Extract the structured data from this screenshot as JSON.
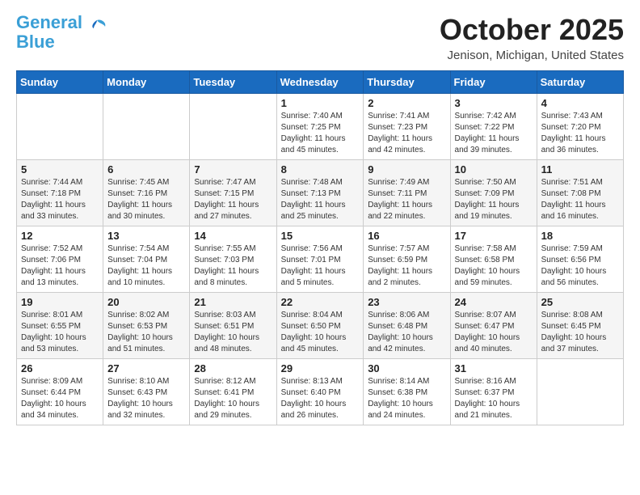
{
  "header": {
    "logo_line1": "General",
    "logo_line2": "Blue",
    "month_title": "October 2025",
    "location": "Jenison, Michigan, United States"
  },
  "days_of_week": [
    "Sunday",
    "Monday",
    "Tuesday",
    "Wednesday",
    "Thursday",
    "Friday",
    "Saturday"
  ],
  "weeks": [
    [
      {
        "num": "",
        "info": ""
      },
      {
        "num": "",
        "info": ""
      },
      {
        "num": "",
        "info": ""
      },
      {
        "num": "1",
        "info": "Sunrise: 7:40 AM\nSunset: 7:25 PM\nDaylight: 11 hours and 45 minutes."
      },
      {
        "num": "2",
        "info": "Sunrise: 7:41 AM\nSunset: 7:23 PM\nDaylight: 11 hours and 42 minutes."
      },
      {
        "num": "3",
        "info": "Sunrise: 7:42 AM\nSunset: 7:22 PM\nDaylight: 11 hours and 39 minutes."
      },
      {
        "num": "4",
        "info": "Sunrise: 7:43 AM\nSunset: 7:20 PM\nDaylight: 11 hours and 36 minutes."
      }
    ],
    [
      {
        "num": "5",
        "info": "Sunrise: 7:44 AM\nSunset: 7:18 PM\nDaylight: 11 hours and 33 minutes."
      },
      {
        "num": "6",
        "info": "Sunrise: 7:45 AM\nSunset: 7:16 PM\nDaylight: 11 hours and 30 minutes."
      },
      {
        "num": "7",
        "info": "Sunrise: 7:47 AM\nSunset: 7:15 PM\nDaylight: 11 hours and 27 minutes."
      },
      {
        "num": "8",
        "info": "Sunrise: 7:48 AM\nSunset: 7:13 PM\nDaylight: 11 hours and 25 minutes."
      },
      {
        "num": "9",
        "info": "Sunrise: 7:49 AM\nSunset: 7:11 PM\nDaylight: 11 hours and 22 minutes."
      },
      {
        "num": "10",
        "info": "Sunrise: 7:50 AM\nSunset: 7:09 PM\nDaylight: 11 hours and 19 minutes."
      },
      {
        "num": "11",
        "info": "Sunrise: 7:51 AM\nSunset: 7:08 PM\nDaylight: 11 hours and 16 minutes."
      }
    ],
    [
      {
        "num": "12",
        "info": "Sunrise: 7:52 AM\nSunset: 7:06 PM\nDaylight: 11 hours and 13 minutes."
      },
      {
        "num": "13",
        "info": "Sunrise: 7:54 AM\nSunset: 7:04 PM\nDaylight: 11 hours and 10 minutes."
      },
      {
        "num": "14",
        "info": "Sunrise: 7:55 AM\nSunset: 7:03 PM\nDaylight: 11 hours and 8 minutes."
      },
      {
        "num": "15",
        "info": "Sunrise: 7:56 AM\nSunset: 7:01 PM\nDaylight: 11 hours and 5 minutes."
      },
      {
        "num": "16",
        "info": "Sunrise: 7:57 AM\nSunset: 6:59 PM\nDaylight: 11 hours and 2 minutes."
      },
      {
        "num": "17",
        "info": "Sunrise: 7:58 AM\nSunset: 6:58 PM\nDaylight: 10 hours and 59 minutes."
      },
      {
        "num": "18",
        "info": "Sunrise: 7:59 AM\nSunset: 6:56 PM\nDaylight: 10 hours and 56 minutes."
      }
    ],
    [
      {
        "num": "19",
        "info": "Sunrise: 8:01 AM\nSunset: 6:55 PM\nDaylight: 10 hours and 53 minutes."
      },
      {
        "num": "20",
        "info": "Sunrise: 8:02 AM\nSunset: 6:53 PM\nDaylight: 10 hours and 51 minutes."
      },
      {
        "num": "21",
        "info": "Sunrise: 8:03 AM\nSunset: 6:51 PM\nDaylight: 10 hours and 48 minutes."
      },
      {
        "num": "22",
        "info": "Sunrise: 8:04 AM\nSunset: 6:50 PM\nDaylight: 10 hours and 45 minutes."
      },
      {
        "num": "23",
        "info": "Sunrise: 8:06 AM\nSunset: 6:48 PM\nDaylight: 10 hours and 42 minutes."
      },
      {
        "num": "24",
        "info": "Sunrise: 8:07 AM\nSunset: 6:47 PM\nDaylight: 10 hours and 40 minutes."
      },
      {
        "num": "25",
        "info": "Sunrise: 8:08 AM\nSunset: 6:45 PM\nDaylight: 10 hours and 37 minutes."
      }
    ],
    [
      {
        "num": "26",
        "info": "Sunrise: 8:09 AM\nSunset: 6:44 PM\nDaylight: 10 hours and 34 minutes."
      },
      {
        "num": "27",
        "info": "Sunrise: 8:10 AM\nSunset: 6:43 PM\nDaylight: 10 hours and 32 minutes."
      },
      {
        "num": "28",
        "info": "Sunrise: 8:12 AM\nSunset: 6:41 PM\nDaylight: 10 hours and 29 minutes."
      },
      {
        "num": "29",
        "info": "Sunrise: 8:13 AM\nSunset: 6:40 PM\nDaylight: 10 hours and 26 minutes."
      },
      {
        "num": "30",
        "info": "Sunrise: 8:14 AM\nSunset: 6:38 PM\nDaylight: 10 hours and 24 minutes."
      },
      {
        "num": "31",
        "info": "Sunrise: 8:16 AM\nSunset: 6:37 PM\nDaylight: 10 hours and 21 minutes."
      },
      {
        "num": "",
        "info": ""
      }
    ]
  ]
}
